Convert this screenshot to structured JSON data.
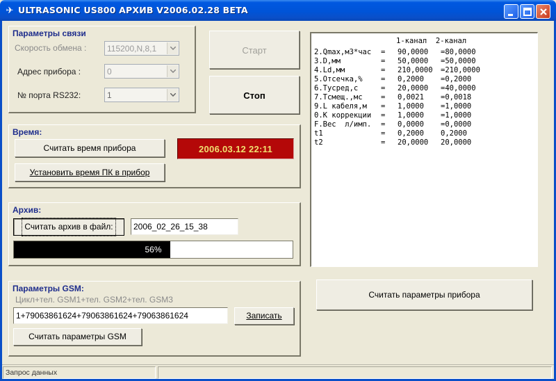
{
  "window": {
    "title": "ULTRASONIC US800 АРХИВ V2006.02.28 BETA",
    "title_color": "#0054d8"
  },
  "connection": {
    "title": "Параметры связи",
    "speed_label": "Скорость обмена :",
    "speed_value": "115200,N,8,1",
    "address_label": "Адрес прибора :",
    "address_value": "0",
    "port_label": "№ порта RS232:",
    "port_value": "1"
  },
  "controls": {
    "start_label": "Старт",
    "stop_label": "Стоп"
  },
  "time": {
    "title": "Время:",
    "read_button": "Считать время прибора",
    "set_button": "Установить время ПК в прибор",
    "clock_value": "2006.03.12 22:11",
    "clock_bg": "#b40808",
    "clock_fg": "#f0e070"
  },
  "archive": {
    "title": "Архив:",
    "read_button": "Считать архив в файл:",
    "filename": "2006_02_26_15_38",
    "progress_percent": 56,
    "progress_text": "56%"
  },
  "gsm": {
    "title": "Параметры GSM:",
    "columns_hint": "Цикл+тел. GSM1+тел. GSM2+тел. GSM3",
    "value": "1+79063861624+79063861624+79063861624",
    "write_button": "Записать",
    "read_button": "Считать параметры GSM"
  },
  "params": {
    "header_c1": "1-канал",
    "header_c2": "2-канал",
    "rows": [
      {
        "name": "2.Qmax,м3*час",
        "eq": "=",
        "c1": "90,0000",
        "c2": "=80,0000"
      },
      {
        "name": "3.D,мм",
        "eq": "=",
        "c1": "50,0000",
        "c2": "=50,0000"
      },
      {
        "name": "4.Ld,мм",
        "eq": "=",
        "c1": "210,0000",
        "c2": "=210,0000"
      },
      {
        "name": "5.Отсечка,%",
        "eq": "=",
        "c1": "0,2000",
        "c2": "=0,2000"
      },
      {
        "name": "6.Tусред,с",
        "eq": "=",
        "c1": "20,0000",
        "c2": "=40,0000"
      },
      {
        "name": "7.Tсмещ.,мс",
        "eq": "=",
        "c1": "0,0021",
        "c2": "=0,0018"
      },
      {
        "name": "9.L кабеля,м",
        "eq": "=",
        "c1": "1,0000",
        "c2": "=1,0000"
      },
      {
        "name": "0.К коррекции",
        "eq": "=",
        "c1": "1,0000",
        "c2": "=1,0000"
      },
      {
        "name": "F.Вес  л/имп.",
        "eq": "=",
        "c1": "0,0000",
        "c2": "=0,0000"
      },
      {
        "name": "t1",
        "eq": "=",
        "c1": "0,2000",
        "c2": "0,2000"
      },
      {
        "name": "t2",
        "eq": "=",
        "c1": "20,0000",
        "c2": "20,0000"
      }
    ],
    "read_button": "Считать параметры прибора"
  },
  "status": {
    "text": "Запрос данных"
  }
}
